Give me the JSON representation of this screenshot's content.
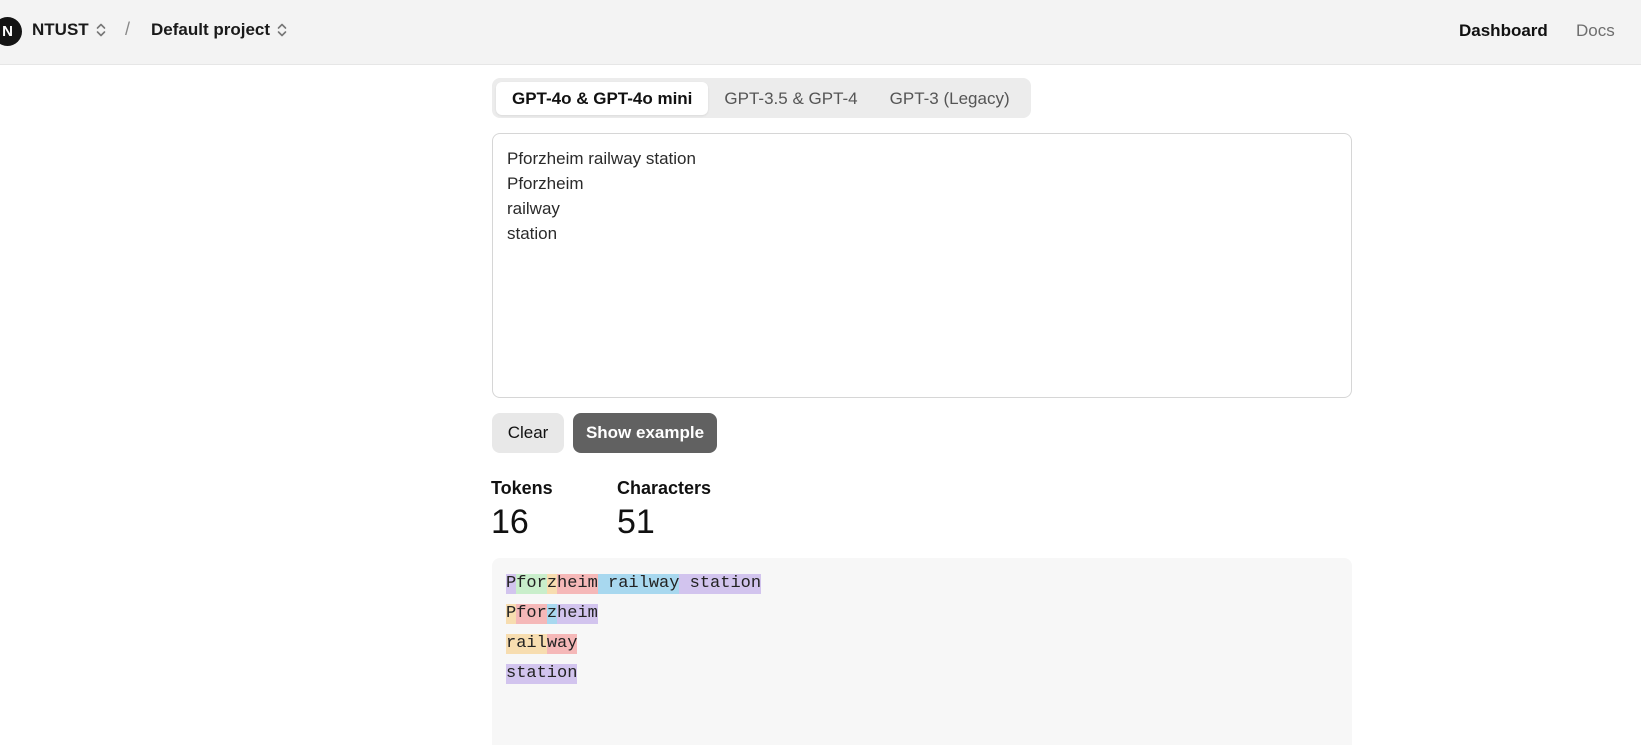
{
  "header": {
    "avatar_letter": "N",
    "org": "NTUST",
    "separator": "/",
    "project": "Default project",
    "nav": {
      "dashboard": "Dashboard",
      "docs": "Docs"
    }
  },
  "tabs": [
    {
      "label": "GPT-4o & GPT-4o mini",
      "active": true
    },
    {
      "label": "GPT-3.5 & GPT-4",
      "active": false
    },
    {
      "label": "GPT-3 (Legacy)",
      "active": false
    }
  ],
  "input": {
    "value": "Pforzheim railway station\nPforzheim\nrailway\nstation"
  },
  "buttons": {
    "clear": "Clear",
    "show_example": "Show example"
  },
  "stats": {
    "tokens_label": "Tokens",
    "tokens_value": "16",
    "characters_label": "Characters",
    "characters_value": "51"
  },
  "token_colors": {
    "purple": "#d2c4ee",
    "green": "#c9eecb",
    "orange": "#f7ddb0",
    "red": "#f5b8b8",
    "blue": "#a8d8ef"
  },
  "token_lines": [
    [
      {
        "text": "P",
        "color": "purple"
      },
      {
        "text": "for",
        "color": "green"
      },
      {
        "text": "z",
        "color": "orange"
      },
      {
        "text": "heim",
        "color": "red"
      },
      {
        "text": " railway",
        "color": "blue"
      },
      {
        "text": " station",
        "color": "purple"
      }
    ],
    [
      {
        "text": "P",
        "color": "orange"
      },
      {
        "text": "for",
        "color": "red"
      },
      {
        "text": "z",
        "color": "blue"
      },
      {
        "text": "heim",
        "color": "purple"
      }
    ],
    [
      {
        "text": "rail",
        "color": "orange"
      },
      {
        "text": "way",
        "color": "red"
      }
    ],
    [
      {
        "text": "station",
        "color": "purple"
      }
    ]
  ]
}
